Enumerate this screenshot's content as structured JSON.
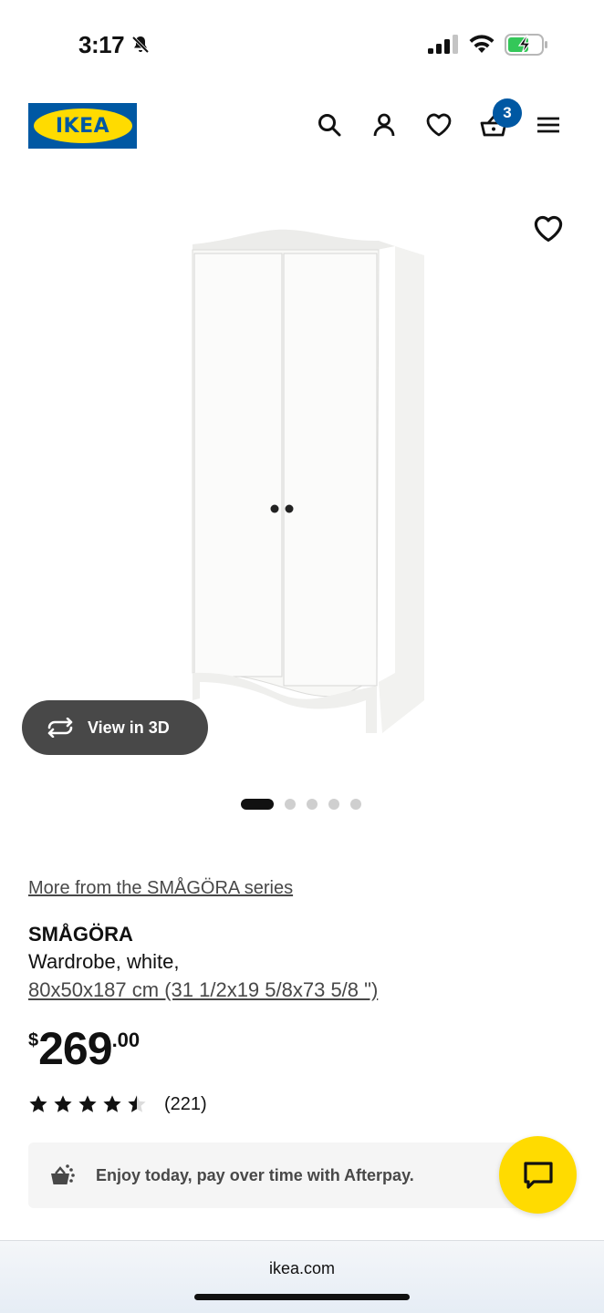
{
  "status_bar": {
    "time": "3:17",
    "icons": [
      "bell-slash-icon",
      "signal-icon",
      "wifi-icon",
      "battery-charging-icon"
    ]
  },
  "header": {
    "logo_text": "IKEA",
    "icons": [
      "search-icon",
      "account-icon",
      "heart-icon",
      "cart-icon",
      "menu-icon"
    ],
    "cart_count": "3",
    "brand_colors": {
      "blue": "#0058a3",
      "yellow": "#ffdb00"
    }
  },
  "gallery": {
    "view_3d_label": "View in 3D",
    "image_count": 5,
    "active_index": 0
  },
  "product": {
    "series_link": "More from the SMÅGÖRA series",
    "name": "SMÅGÖRA",
    "description": "Wardrobe, white,",
    "dimensions": "80x50x187 cm (31 1/2x19 5/8x73 5/8 \")",
    "price_currency": "$",
    "price_integer": "269",
    "price_decimal": ".00",
    "rating": 4.5,
    "review_count": "(221)"
  },
  "afterpay": {
    "text": "Enjoy today, pay over time with Afterpay."
  },
  "chat": {
    "icon": "chat-icon",
    "color": "#ffdb00"
  },
  "browser": {
    "url": "ikea.com"
  }
}
